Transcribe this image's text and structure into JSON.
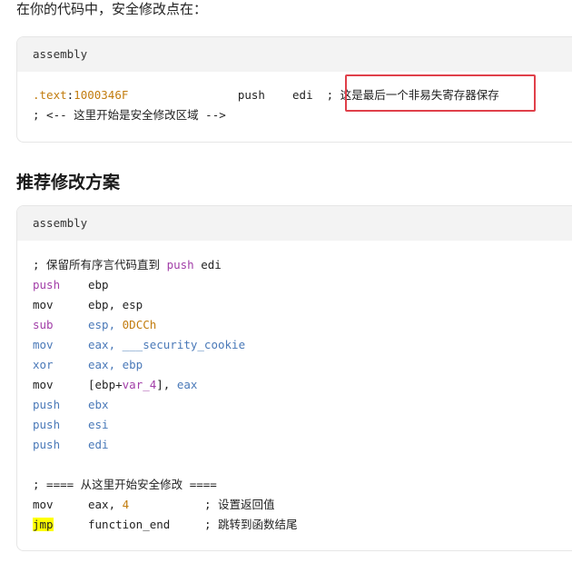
{
  "intro_text": "在你的代码中，安全修改点在：",
  "card1": {
    "language": "assembly",
    "line1": {
      "section": ".text",
      "colon": ":",
      "address": "1000346F",
      "gap": "                ",
      "mnemonic": "push",
      "space": "    ",
      "operand": "edi",
      "comment_prefix": "  ;",
      "comment": "这是最后一个非易失寄存器保存"
    },
    "line2": {
      "comment": "; <-- 这里开始是安全修改区域 -->"
    }
  },
  "section_title": "推荐修改方案",
  "card2": {
    "language": "assembly",
    "comment_top_prefix": "; 保留所有序言代码直到 ",
    "comment_top_keyword": "push",
    "comment_top_suffix": " edi",
    "instructions": [
      {
        "mnemonic": "push",
        "operands": "ebp"
      },
      {
        "mnemonic": "mov",
        "operands": "ebp, esp"
      },
      {
        "mnemonic": "sub",
        "op_a": "esp, ",
        "op_b": "0DCCh"
      },
      {
        "mnemonic": "mov",
        "operands": "eax, ___security_cookie"
      },
      {
        "mnemonic": "xor",
        "operands": "eax, ebp"
      },
      {
        "mnemonic": "mov",
        "op_a": "[ebp+",
        "op_b": "var_4",
        "op_c": "], ",
        "op_d": "eax"
      },
      {
        "mnemonic": "push",
        "operands": "ebx"
      },
      {
        "mnemonic": "push",
        "operands": "esi"
      },
      {
        "mnemonic": "push",
        "operands": "edi"
      }
    ],
    "comment_mid": "; ==== 从这里开始安全修改 ====",
    "mov_line": {
      "mnemonic": "mov",
      "op_a": "eax, ",
      "op_b": "4",
      "comment": "; 设置返回值"
    },
    "jmp_line": {
      "mnemonic": "jmp",
      "operand": "function_end",
      "comment": "; 跳转到函数结尾"
    }
  }
}
